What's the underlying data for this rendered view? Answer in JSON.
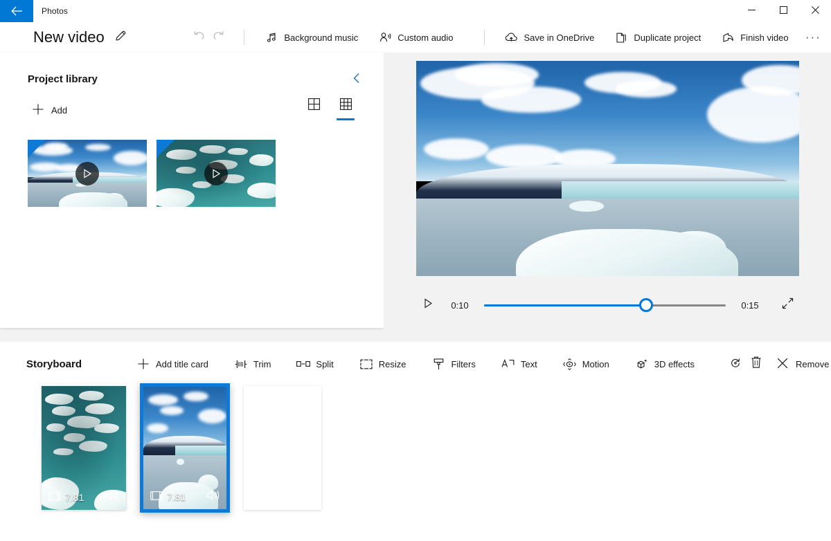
{
  "titlebar": {
    "back_label": "Back",
    "app_name": "Photos",
    "minimize_label": "Minimize",
    "maximize_label": "Maximize",
    "close_label": "Close"
  },
  "commandbar": {
    "project_title": "New video",
    "rename_label": "Rename",
    "undo_label": "Undo",
    "redo_label": "Redo",
    "background_music": "Background music",
    "custom_audio": "Custom audio",
    "save_in_onedrive": "Save in OneDrive",
    "duplicate_project": "Duplicate project",
    "finish_video": "Finish video",
    "more_label": "···"
  },
  "library": {
    "title": "Project library",
    "collapse_label": "Collapse",
    "add_label": "Add",
    "view_large_label": "Large grid view",
    "view_small_label": "Small grid view",
    "active_view": "small",
    "items": [
      {
        "name": "glacier-lagoon-clip",
        "scene": "glacier",
        "in_storyboard": true,
        "play_label": "Play"
      },
      {
        "name": "ice-floes-clip",
        "scene": "floes",
        "in_storyboard": true,
        "play_label": "Play"
      }
    ]
  },
  "preview": {
    "scene": "glacier",
    "play_label": "Play",
    "current_time": "0:10",
    "total_time": "0:15",
    "progress_percent": 67,
    "fullscreen_label": "Full screen"
  },
  "storyboard": {
    "title": "Storyboard",
    "add_title_card": "Add title card",
    "trim": "Trim",
    "split": "Split",
    "resize": "Resize",
    "filters": "Filters",
    "text": "Text",
    "motion": "Motion",
    "effects_3d": "3D effects",
    "rotate_label": "Rotate",
    "delete_label": "Delete",
    "remove_all": "Remove all",
    "cards": [
      {
        "name": "ice-floes-card",
        "scene": "floes",
        "duration": "7.81",
        "selected": false,
        "audio_on": true
      },
      {
        "name": "glacier-lagoon-card",
        "scene": "glacier",
        "duration": "7.81",
        "selected": true,
        "audio_on": true
      }
    ]
  },
  "colors": {
    "accent": "#0078d4",
    "selection": "#0f79d6",
    "panel": "#ffffff",
    "app_background": "#f2f2f2"
  }
}
